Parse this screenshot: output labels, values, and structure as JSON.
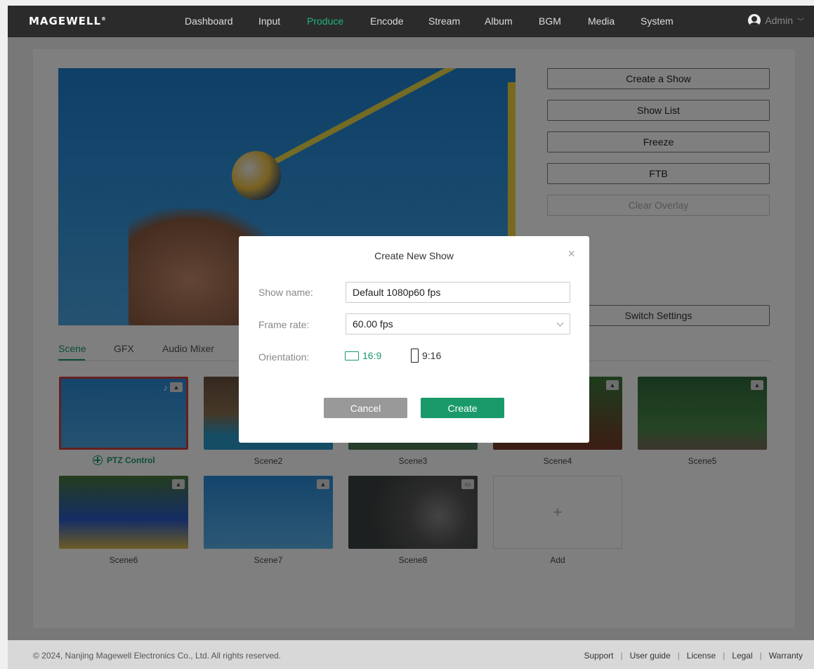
{
  "brand": {
    "logo": "MAGEWELL",
    "reg": "®"
  },
  "nav": {
    "items": [
      "Dashboard",
      "Input",
      "Produce",
      "Encode",
      "Stream",
      "Album",
      "BGM",
      "Media",
      "System"
    ],
    "active": "Produce",
    "user": "Admin"
  },
  "right_buttons": {
    "create_show": "Create a Show",
    "show_list": "Show List",
    "freeze": "Freeze",
    "ftb": "FTB",
    "clear_overlay": "Clear Overlay",
    "switch_settings": "Switch Settings"
  },
  "tabs": [
    "Scene",
    "GFX",
    "Audio Mixer"
  ],
  "scenes": {
    "ptz_control": "PTZ Control",
    "labels": [
      "Scene2",
      "Scene3",
      "Scene4",
      "Scene5",
      "Scene6",
      "Scene7",
      "Scene8"
    ],
    "add": "Add"
  },
  "modal": {
    "title": "Create New Show",
    "show_name_label": "Show name:",
    "show_name_value": "Default 1080p60 fps",
    "frame_rate_label": "Frame rate:",
    "frame_rate_value": "60.00 fps",
    "orientation_label": "Orientation:",
    "orientation_landscape": "16:9",
    "orientation_portrait": "9:16",
    "cancel": "Cancel",
    "create": "Create"
  },
  "footer": {
    "copyright": "© 2024, Nanjing Magewell Electronics Co., Ltd. All rights reserved.",
    "links": [
      "Support",
      "User guide",
      "License",
      "Legal",
      "Warranty"
    ]
  },
  "colors": {
    "accent": "#1a9a6a",
    "header": "#2b2b2b",
    "selected_border": "#c94040"
  }
}
